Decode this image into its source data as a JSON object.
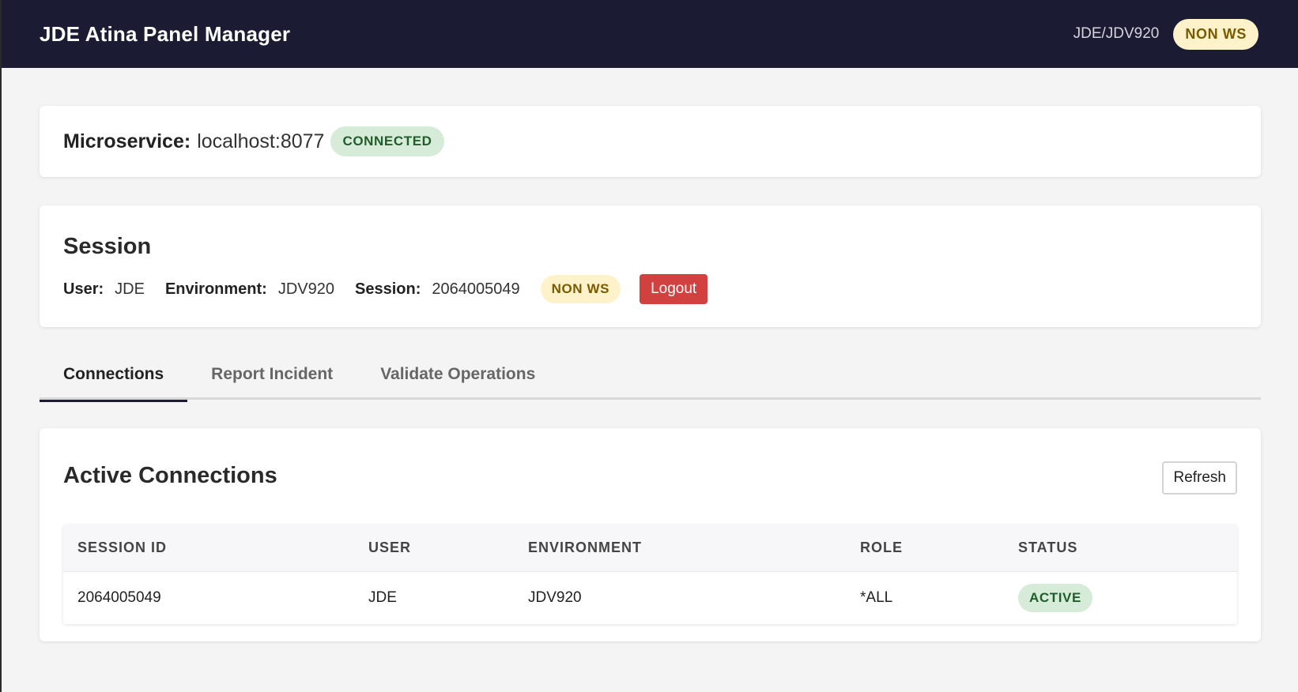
{
  "header": {
    "app_title": "JDE Atina Panel Manager",
    "env_path": "JDE/JDV920",
    "mode_badge": "NON WS"
  },
  "microservice": {
    "label": "Microservice:",
    "value": "localhost:8077",
    "status": "CONNECTED"
  },
  "session": {
    "title": "Session",
    "user_label": "User:",
    "user": "JDE",
    "environment_label": "Environment:",
    "environment": "JDV920",
    "session_label": "Session:",
    "session_id": "2064005049",
    "mode_badge": "NON WS",
    "logout_label": "Logout"
  },
  "tabs": [
    {
      "label": "Connections",
      "active": true
    },
    {
      "label": "Report Incident",
      "active": false
    },
    {
      "label": "Validate Operations",
      "active": false
    }
  ],
  "connections": {
    "title": "Active Connections",
    "refresh_label": "Refresh",
    "columns": [
      "SESSION ID",
      "USER",
      "ENVIRONMENT",
      "ROLE",
      "STATUS"
    ],
    "rows": [
      {
        "session_id": "2064005049",
        "user": "JDE",
        "environment": "JDV920",
        "role": "*ALL",
        "status": "ACTIVE"
      }
    ]
  },
  "colors": {
    "header_bg": "#1b1c33",
    "warn_badge_bg": "#fdf2c9",
    "ok_badge_bg": "#d6ecd8",
    "logout_bg": "#d0413f"
  }
}
